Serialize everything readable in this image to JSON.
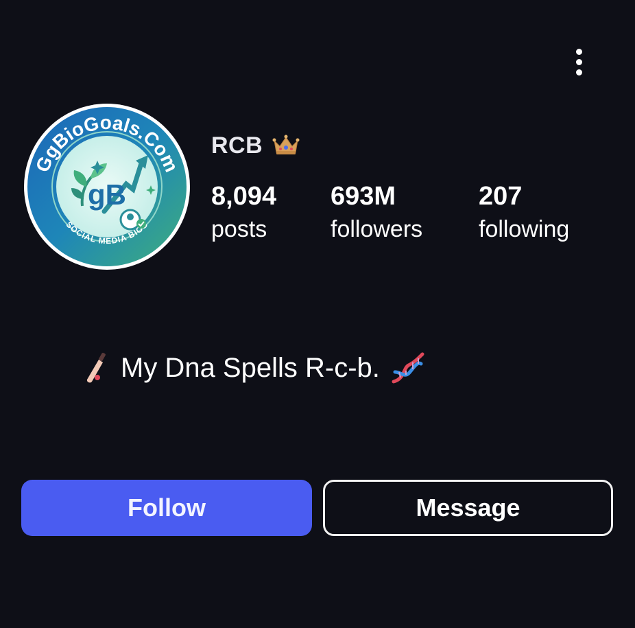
{
  "header": {
    "more_icon": "more-vertical-icon"
  },
  "profile": {
    "avatar": {
      "icon": "profile-logo",
      "ring_text_top": "GgBioGoals.Com",
      "ring_text_bottom": "SOCIAL MEDIA BIOS",
      "monogram": "gB"
    },
    "username": "RCB",
    "username_icon": "crown-icon",
    "stats": [
      {
        "value": "8,094",
        "label": "posts"
      },
      {
        "value": "693M",
        "label": "followers"
      },
      {
        "value": "207",
        "label": "following"
      }
    ],
    "bio": {
      "text": "My Dna Spells R-c-b.",
      "leading_icon": "cricket-bat-icon",
      "trailing_icon": "dna-icon"
    }
  },
  "actions": {
    "follow_label": "Follow",
    "message_label": "Message"
  },
  "colors": {
    "background": "#0e0f17",
    "follow_button": "#4a5cf1",
    "text": "#ffffff"
  }
}
